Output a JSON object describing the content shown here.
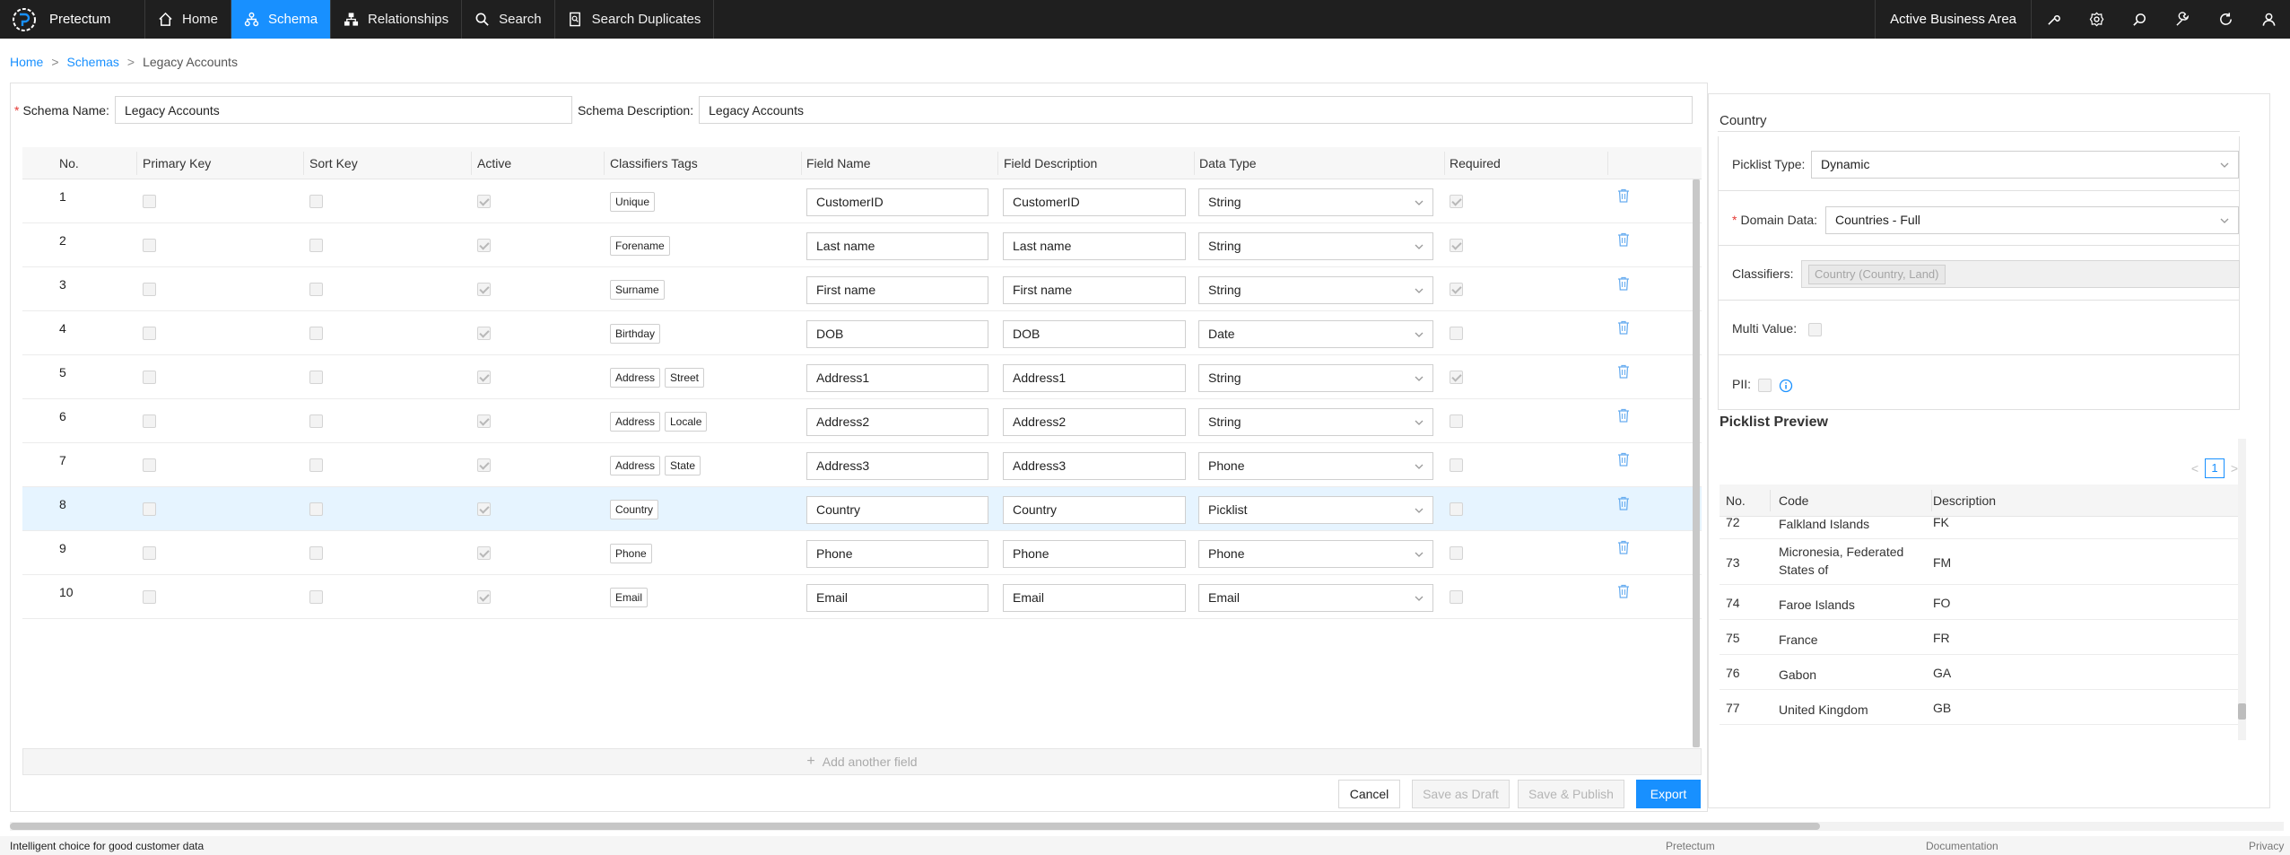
{
  "nav": {
    "brand": "Pretectum",
    "items": [
      {
        "label": "Home",
        "icon": "home-icon"
      },
      {
        "label": "Schema",
        "icon": "schema-icon",
        "active": true
      },
      {
        "label": "Relationships",
        "icon": "relationships-icon"
      },
      {
        "label": "Search",
        "icon": "search-icon"
      },
      {
        "label": "Search Duplicates",
        "icon": "duplicates-icon"
      }
    ],
    "business_area": "Active Business Area",
    "right_icons": [
      "tools-icon",
      "settings-icon",
      "search-icon",
      "wrench-icon",
      "refresh-icon",
      "user-icon"
    ],
    "active_color": "#1890ff",
    "bar_color": "#1f1f1f"
  },
  "breadcrumb": {
    "home": "Home",
    "schemas": "Schemas",
    "current": "Legacy Accounts",
    "separator": ">"
  },
  "schema": {
    "name_label": "Schema Name",
    "name_value": "Legacy Accounts",
    "desc_label": "Schema Description",
    "desc_value": "Legacy Accounts"
  },
  "table": {
    "headers": [
      "No.",
      "Primary Key",
      "Sort Key",
      "Active",
      "Classifiers Tags",
      "Field Name",
      "Field Description",
      "Data Type",
      "Required"
    ],
    "rows": [
      {
        "no": "1",
        "tags": [
          "Unique"
        ],
        "field_name": "CustomerID",
        "field_desc": "CustomerID",
        "data_type": "String",
        "active": true,
        "required": true
      },
      {
        "no": "2",
        "tags": [
          "Forename"
        ],
        "field_name": "Last name",
        "field_desc": "Last name",
        "data_type": "String",
        "active": true,
        "required": true
      },
      {
        "no": "3",
        "tags": [
          "Surname"
        ],
        "field_name": "First name",
        "field_desc": "First name",
        "data_type": "String",
        "active": true,
        "required": true
      },
      {
        "no": "4",
        "tags": [
          "Birthday"
        ],
        "field_name": "DOB",
        "field_desc": "DOB",
        "data_type": "Date",
        "active": true,
        "required": false
      },
      {
        "no": "5",
        "tags": [
          "Address",
          "Street"
        ],
        "field_name": "Address1",
        "field_desc": "Address1",
        "data_type": "String",
        "active": true,
        "required": true
      },
      {
        "no": "6",
        "tags": [
          "Address",
          "Locale"
        ],
        "field_name": "Address2",
        "field_desc": "Address2",
        "data_type": "String",
        "active": true,
        "required": false
      },
      {
        "no": "7",
        "tags": [
          "Address",
          "State"
        ],
        "field_name": "Address3",
        "field_desc": "Address3",
        "data_type": "Phone",
        "active": true,
        "required": false
      },
      {
        "no": "8",
        "tags": [
          "Country"
        ],
        "field_name": "Country",
        "field_desc": "Country",
        "data_type": "Picklist",
        "active": true,
        "required": false,
        "selected": true
      },
      {
        "no": "9",
        "tags": [
          "Phone"
        ],
        "field_name": "Phone",
        "field_desc": "Phone",
        "data_type": "Phone",
        "active": true,
        "required": false
      },
      {
        "no": "10",
        "tags": [
          "Email"
        ],
        "field_name": "Email",
        "field_desc": "Email",
        "data_type": "Email",
        "active": true,
        "required": false
      }
    ],
    "add_field_label": "Add another field"
  },
  "actions": {
    "cancel": "Cancel",
    "save_draft": "Save as Draft",
    "save_publish": "Save & Publish",
    "export": "Export"
  },
  "panel": {
    "title": "Country",
    "picklist_type_label": "Picklist Type",
    "picklist_type_value": "Dynamic",
    "domain_data_label": "Domain Data",
    "domain_data_value": "Countries - Full",
    "classifiers_label": "Classifiers",
    "classifiers_value": "Country (Country, Land)",
    "multi_value_label": "Multi Value",
    "pii_label": "PII",
    "preview_title": "Picklist Preview",
    "pager": {
      "prev": "<",
      "page": "1",
      "next": ">"
    },
    "preview_headers": [
      "No.",
      "Code",
      "Description"
    ],
    "preview_rows": [
      {
        "no": "72",
        "code": "Falkland Islands",
        "desc": "FK"
      },
      {
        "no": "73",
        "code": "Micronesia, Federated States of",
        "desc": "FM"
      },
      {
        "no": "74",
        "code": "Faroe Islands",
        "desc": "FO"
      },
      {
        "no": "75",
        "code": "France",
        "desc": "FR"
      },
      {
        "no": "76",
        "code": "Gabon",
        "desc": "GA"
      },
      {
        "no": "77",
        "code": "United Kingdom",
        "desc": "GB"
      }
    ]
  },
  "footer": {
    "tagline": "Intelligent choice for good customer data",
    "brand": "Pretectum",
    "docs": "Documentation",
    "privacy": "Privacy"
  }
}
